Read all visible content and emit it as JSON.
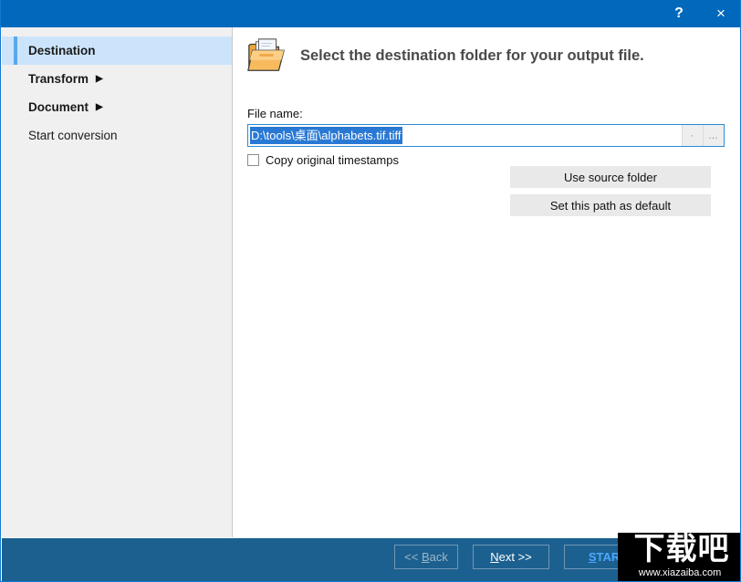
{
  "window": {
    "titlebar": {
      "help_label": "?",
      "close_label": "×",
      "background_color": "#0069bc"
    }
  },
  "sidebar": {
    "background_color": "#f0f0f0",
    "active_background_color": "#cce4fb",
    "accent_color": "#5aa7ea",
    "items": [
      {
        "label": "Destination",
        "active": true,
        "has_arrow": false,
        "bold": true
      },
      {
        "label": "Transform",
        "active": false,
        "has_arrow": true,
        "bold": true,
        "arrow": "▶"
      },
      {
        "label": "Document",
        "active": false,
        "has_arrow": true,
        "bold": true,
        "arrow": "▶"
      },
      {
        "label": "Start conversion",
        "active": false,
        "has_arrow": false,
        "bold": false
      }
    ]
  },
  "main": {
    "page_title": "Select the destination folder for your output file.",
    "icon": "open-folder-icon",
    "file_name": {
      "label": "File name:",
      "value": "D:\\tools\\桌面\\alphabets.tif.tiff",
      "selected": true,
      "selection_color": "#2979d4",
      "dot_button_label": "·",
      "browse_button_label": "…"
    },
    "copy_timestamps": {
      "label": "Copy original timestamps",
      "checked": false
    },
    "actions": [
      {
        "label": "Use source folder"
      },
      {
        "label": "Set this path as default"
      }
    ]
  },
  "footer": {
    "background_color": "#1c608f",
    "buttons": [
      {
        "label": "<< Back",
        "mnemonic": "B",
        "state": "disabled"
      },
      {
        "label": "Next >>",
        "mnemonic": "N",
        "state": "enabled"
      },
      {
        "label": "START",
        "mnemonic": "S",
        "state": "enabled"
      }
    ]
  },
  "watermark": {
    "logo_text": "下载吧",
    "url_text": "www.xiazaiba.com"
  }
}
